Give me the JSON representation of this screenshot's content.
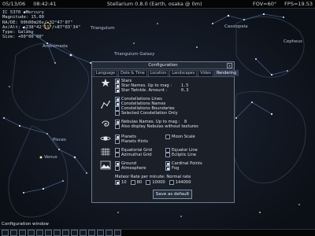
{
  "topbar": {
    "date": "05/13/06",
    "time": "08:42:41",
    "title": "Stellarium 0.8.0 (Earth, osaka @ 0m)",
    "fov": "FOV=60°",
    "fps": "FPS=19.53"
  },
  "object_info": {
    "line1": "IC 5370  ◆Mercury",
    "line2": "Magnitude: 15.00",
    "line3": "RA/DE: 00h00m26s/+32°47'07\"",
    "line4": "Az/Alt: +238°42'11\"/+87°03'34\"",
    "line5": "Type: Galaxy",
    "line6": "Size: +00°00'00\""
  },
  "sky_labels": {
    "andromeda": "Andromeda",
    "triangulum": "Triangulum",
    "cassiopeia": "Cassiopeia",
    "cepheus": "Cepheus",
    "pisces": "Pisces",
    "venus": "Venus",
    "gal": "Triangulum Galaxy"
  },
  "dialog": {
    "title": "Configuration",
    "close": "x",
    "tabs": [
      "Language",
      "Date & Time",
      "Location",
      "Landscapes",
      "Video",
      "Rendering"
    ],
    "stars": {
      "stars": "Stars",
      "star_names": "Star Names. Up to mag :",
      "star_names_val": "1.5",
      "star_twinkle": "Star Twinkle. Amount :",
      "star_twinkle_val": "0.3"
    },
    "constellations": {
      "lines": "Constellations Lines",
      "names": "Constellations Names",
      "boundaries": "Constellations Boundaries",
      "selected_only": "Selected Constellation Only"
    },
    "nebulas": {
      "names": "Nebulas Names. Up to mag :",
      "names_val": "8",
      "textures": "Also display Nebulas without textures"
    },
    "planets": {
      "planets": "Planets",
      "moon_scale": "Moon Scale",
      "hints": "Planets Hints"
    },
    "grids": {
      "equatorial": "Equatorial Grid",
      "equator_line": "Equator Line",
      "azimuthal": "Azimuthal Grid",
      "ecliptic_line": "Ecliptic Line"
    },
    "landscape": {
      "ground": "Ground",
      "cardinal": "Cardinal Points",
      "atmosphere": "Atmosphere",
      "fog": "Fog"
    },
    "meteor": {
      "label": "Meteor Rate per minute: Normal rate",
      "options": [
        "10",
        "80",
        "10000",
        "144000"
      ]
    },
    "save_button": "Save as default"
  },
  "bottom": {
    "config_window_label": "Configuration window"
  }
}
